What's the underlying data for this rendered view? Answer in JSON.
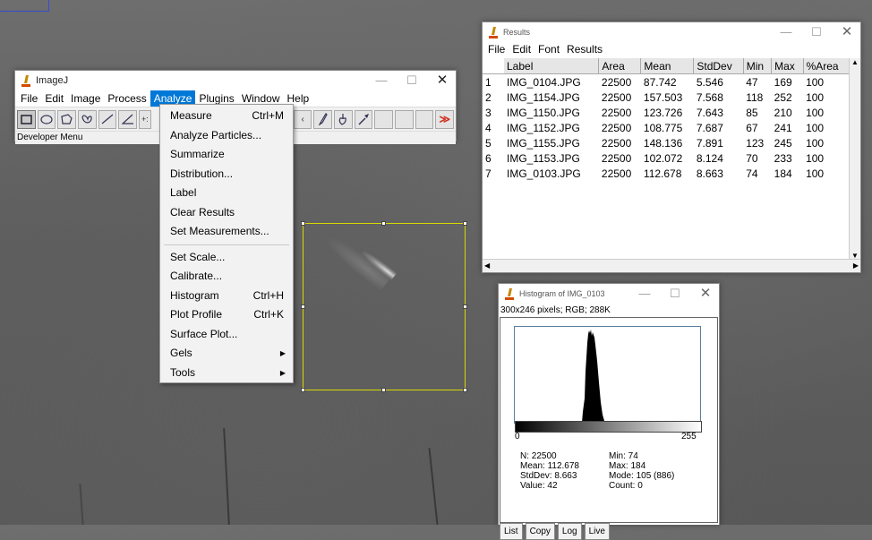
{
  "imagej": {
    "title": "ImageJ",
    "menu": [
      "File",
      "Edit",
      "Image",
      "Process",
      "Analyze",
      "Plugins",
      "Window",
      "Help"
    ],
    "active_menu": "Analyze",
    "status": "Developer Menu",
    "tool_icons": [
      "rectangle-tool-icon",
      "oval-tool-icon",
      "polygon-tool-icon",
      "freehand-tool-icon",
      "line-tool-icon",
      "angle-tool-icon",
      "point-tool-icon"
    ],
    "right_tools": [
      "lut-tool-icon",
      "brush-tool-icon",
      "dropper-tool-icon",
      "pipette-tool-icon"
    ],
    "more_tools_glyph": "≫"
  },
  "analyze_menu": {
    "items": [
      {
        "label": "Measure",
        "shortcut": "Ctrl+M",
        "sub": false
      },
      {
        "label": "Analyze Particles...",
        "shortcut": "",
        "sub": false
      },
      {
        "label": "Summarize",
        "shortcut": "",
        "sub": false
      },
      {
        "label": "Distribution...",
        "shortcut": "",
        "sub": false
      },
      {
        "label": "Label",
        "shortcut": "",
        "sub": false
      },
      {
        "label": "Clear Results",
        "shortcut": "",
        "sub": false
      },
      {
        "label": "Set Measurements...",
        "shortcut": "",
        "sub": false
      },
      {
        "separator": true
      },
      {
        "label": "Set Scale...",
        "shortcut": "",
        "sub": false
      },
      {
        "label": "Calibrate...",
        "shortcut": "",
        "sub": false
      },
      {
        "label": "Histogram",
        "shortcut": "Ctrl+H",
        "sub": false
      },
      {
        "label": "Plot Profile",
        "shortcut": "Ctrl+K",
        "sub": false
      },
      {
        "label": "Surface Plot...",
        "shortcut": "",
        "sub": false
      },
      {
        "label": "Gels",
        "shortcut": "",
        "sub": true
      },
      {
        "label": "Tools",
        "shortcut": "",
        "sub": true
      }
    ]
  },
  "results": {
    "title": "Results",
    "menu": [
      "File",
      "Edit",
      "Font",
      "Results"
    ],
    "columns": [
      "",
      "Label",
      "Area",
      "Mean",
      "StdDev",
      "Min",
      "Max",
      "%Area"
    ],
    "rows": [
      [
        "1",
        "IMG_0104.JPG",
        "22500",
        "87.742",
        "5.546",
        "47",
        "169",
        "100"
      ],
      [
        "2",
        "IMG_1154.JPG",
        "22500",
        "157.503",
        "7.568",
        "118",
        "252",
        "100"
      ],
      [
        "3",
        "IMG_1150.JPG",
        "22500",
        "123.726",
        "7.643",
        "85",
        "210",
        "100"
      ],
      [
        "4",
        "IMG_1152.JPG",
        "22500",
        "108.775",
        "7.687",
        "67",
        "241",
        "100"
      ],
      [
        "5",
        "IMG_1155.JPG",
        "22500",
        "148.136",
        "7.891",
        "123",
        "245",
        "100"
      ],
      [
        "6",
        "IMG_1153.JPG",
        "22500",
        "102.072",
        "8.124",
        "70",
        "233",
        "100"
      ],
      [
        "7",
        "IMG_0103.JPG",
        "22500",
        "112.678",
        "8.663",
        "74",
        "184",
        "100"
      ]
    ]
  },
  "histogram": {
    "title": "Histogram of IMG_0103",
    "info": "300x246 pixels; RGB; 288K",
    "axis_min": "0",
    "axis_max": "255",
    "stats_left": [
      "N: 22500",
      "Mean: 112.678",
      "StdDev: 8.663",
      "Value: 42"
    ],
    "stats_right": [
      "Min: 74",
      "Max: 184",
      "Mode: 105 (886)",
      "Count: 0"
    ],
    "buttons": [
      "List",
      "Copy",
      "Log",
      "Live"
    ]
  },
  "window_controls": {
    "minimize": "—",
    "maximize": "☐",
    "close": "✕"
  }
}
